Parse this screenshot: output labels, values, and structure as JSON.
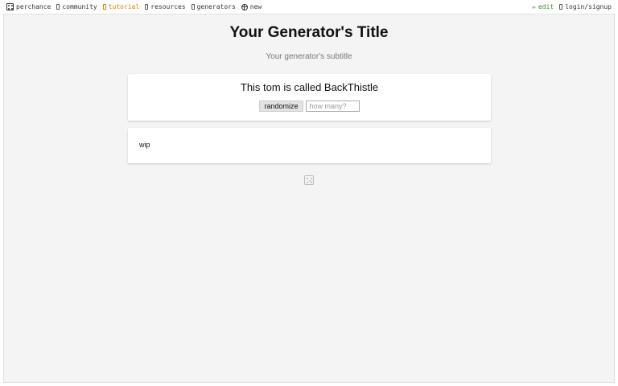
{
  "nav": {
    "left": [
      {
        "label": "perchance",
        "icon": "dice-icon",
        "color": "#333333"
      },
      {
        "label": "community",
        "icon": "community-icon",
        "color": "#333333"
      },
      {
        "label": "tutorial",
        "icon": "book-icon",
        "color": "#e07b00"
      },
      {
        "label": "resources",
        "icon": "resources-icon",
        "color": "#333333"
      },
      {
        "label": "generators",
        "icon": "generators-icon",
        "color": "#333333"
      },
      {
        "label": "new",
        "icon": "plus-circle-icon",
        "color": "#333333"
      }
    ],
    "edit_label": "edit",
    "edit_color": "#3a8f2a",
    "login_label": "login/signup"
  },
  "generator": {
    "title": "Your Generator's Title",
    "subtitle": "Your generator's subtitle",
    "output": "This tom is called BackThistle",
    "randomize_label": "randomize",
    "count_placeholder": "how many?",
    "notes": "wip"
  }
}
